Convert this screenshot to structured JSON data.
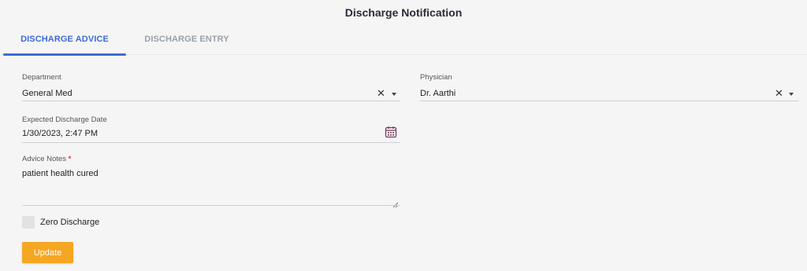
{
  "header": {
    "title": "Discharge Notification"
  },
  "tabs": [
    {
      "label": "DISCHARGE ADVICE",
      "active": true
    },
    {
      "label": "DISCHARGE ENTRY",
      "active": false
    }
  ],
  "form": {
    "department": {
      "label": "Department",
      "value": "General Med"
    },
    "physician": {
      "label": "Physician",
      "value": "Dr. Aarthi"
    },
    "expected_discharge_date": {
      "label": "Expected Discharge Date",
      "value": "1/30/2023, 2:47 PM"
    },
    "advice_notes": {
      "label": "Advice Notes",
      "required_marker": "*",
      "value": "patient health cured"
    },
    "zero_discharge": {
      "label": "Zero Discharge",
      "checked": false
    },
    "update_label": "Update"
  },
  "icons": {
    "clear": "✕",
    "calendar": "calendar-icon",
    "dropdown": "caret-down-icon",
    "resize": "resize-handle-icon"
  },
  "colors": {
    "accent": "#3f6ad8",
    "button": "#f5a623",
    "required": "#e53935",
    "calendar": "#7a3b5e"
  }
}
